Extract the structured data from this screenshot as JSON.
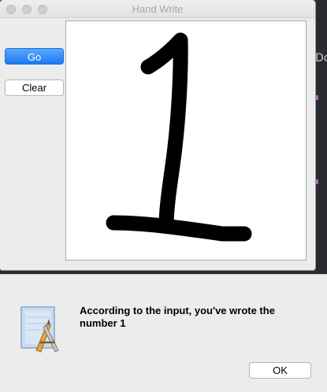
{
  "window": {
    "title": "Hand Write"
  },
  "toolbar": {
    "go_label": "Go",
    "clear_label": "Clear"
  },
  "background": {
    "text_fragment": "Do"
  },
  "dialog": {
    "message": "According to the input, you've wrote the number 1",
    "ok_label": "OK",
    "icon": "app-icon"
  },
  "colors": {
    "accent": "#1f7af5",
    "ink": "#000000",
    "canvas": "#ffffff"
  }
}
